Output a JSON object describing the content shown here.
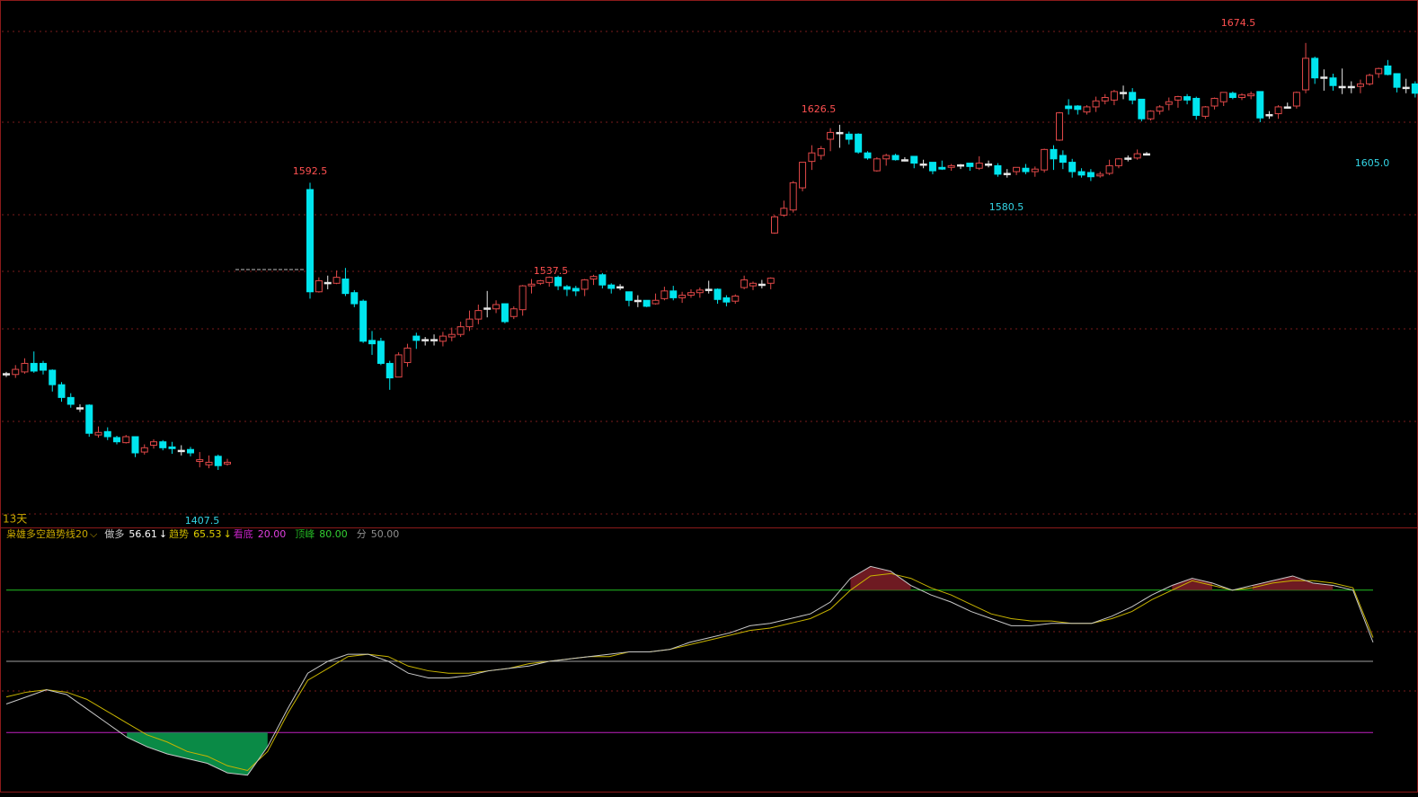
{
  "colors": {
    "background": "#000000",
    "frame": "#8b1a1a",
    "grid": "#7a1c1c",
    "up": "#e04848",
    "down": "#00e5ee",
    "doji": "#e8e8e8",
    "label_high": "#ff5050",
    "label_low": "#33d6e6",
    "indicator_white": "#c8c8c8",
    "indicator_yellow": "#c8b400",
    "line_top": "#22c022",
    "line_mid": "#a0a0a0",
    "line_bottom": "#c020c0",
    "fill_top": "#6e1a22",
    "fill_bottom": "#0a8a46",
    "dashed_ref": "#bbbbbb"
  },
  "chart_data": [
    {
      "type": "candlestick",
      "period_label": "13天",
      "ylim": [
        1395,
        1686
      ],
      "candles": [
        [
          1480.0,
          1480.5,
          1481.5,
          1478.5
        ],
        [
          1480.0,
          1483.0,
          1485.5,
          1478.0
        ],
        [
          1481.5,
          1486.5,
          1489.5,
          1480.5
        ],
        [
          1486.5,
          1482.0,
          1493.5,
          1481.0
        ],
        [
          1486.5,
          1482.5,
          1488.0,
          1480.0
        ],
        [
          1482.5,
          1474.0,
          1483.0,
          1470.0
        ],
        [
          1474.0,
          1466.5,
          1475.5,
          1464.0
        ],
        [
          1466.5,
          1462.5,
          1469.0,
          1460.5
        ],
        [
          1460.5,
          1460.5,
          1462.5,
          1458.0
        ],
        [
          1462.0,
          1445.5,
          1462.5,
          1443.5
        ],
        [
          1444.5,
          1446.0,
          1449.5,
          1443.0
        ],
        [
          1446.5,
          1443.5,
          1449.0,
          1441.5
        ],
        [
          1443.0,
          1440.5,
          1444.0,
          1439.0
        ],
        [
          1440.0,
          1443.5,
          1444.5,
          1439.5
        ],
        [
          1443.5,
          1434.0,
          1443.5,
          1431.5
        ],
        [
          1434.5,
          1437.0,
          1439.0,
          1433.0
        ],
        [
          1438.5,
          1440.5,
          1442.0,
          1436.5
        ],
        [
          1440.5,
          1437.0,
          1441.5,
          1435.5
        ],
        [
          1437.5,
          1436.5,
          1440.5,
          1433.5
        ],
        [
          1435.5,
          1435.5,
          1438.5,
          1432.5
        ],
        [
          1436.0,
          1434.0,
          1437.5,
          1432.0
        ],
        [
          1429.0,
          1430.0,
          1434.5,
          1425.5
        ],
        [
          1427.0,
          1428.5,
          1432.5,
          1425.0
        ],
        [
          1432.0,
          1426.5,
          1433.0,
          1424.0
        ],
        [
          1427.5,
          1428.5,
          1430.5,
          1426.5
        ],
        [
          1588.5,
          1528.5,
          1592.5,
          1524.5
        ],
        [
          1528.5,
          1535.0,
          1537.0,
          1528.0
        ],
        [
          1533.5,
          1534.0,
          1538.0,
          1530.0
        ],
        [
          1533.5,
          1537.0,
          1541.0,
          1533.0
        ],
        [
          1536.0,
          1527.5,
          1542.5,
          1526.0
        ],
        [
          1528.0,
          1521.5,
          1529.5,
          1519.5
        ],
        [
          1523.0,
          1499.5,
          1524.0,
          1498.5
        ],
        [
          1500.0,
          1498.0,
          1505.5,
          1491.5
        ],
        [
          1499.5,
          1486.5,
          1501.5,
          1485.5
        ],
        [
          1486.5,
          1478.0,
          1488.0,
          1471.0
        ],
        [
          1478.5,
          1491.5,
          1493.0,
          1480.0
        ],
        [
          1487.0,
          1495.5,
          1498.0,
          1484.5
        ],
        [
          1502.5,
          1500.0,
          1504.5,
          1495.0
        ],
        [
          1500.5,
          1500.5,
          1502.0,
          1497.0
        ],
        [
          1500.5,
          1500.5,
          1503.5,
          1497.0
        ],
        [
          1499.5,
          1502.5,
          1505.0,
          1496.5
        ],
        [
          1502.0,
          1503.5,
          1507.5,
          1499.5
        ],
        [
          1503.5,
          1508.0,
          1511.0,
          1502.0
        ],
        [
          1508.0,
          1512.5,
          1517.5,
          1505.5
        ],
        [
          1512.5,
          1517.5,
          1521.0,
          1509.5
        ],
        [
          1519.0,
          1518.5,
          1529.0,
          1513.5
        ],
        [
          1518.5,
          1521.0,
          1523.5,
          1516.0
        ],
        [
          1521.5,
          1511.0,
          1521.5,
          1510.0
        ],
        [
          1514.0,
          1518.5,
          1520.0,
          1512.5
        ],
        [
          1518.0,
          1532.0,
          1532.5,
          1514.5
        ],
        [
          1532.0,
          1533.0,
          1536.0,
          1527.5
        ],
        [
          1533.5,
          1535.0,
          1535.5,
          1532.5
        ],
        [
          1534.0,
          1537.0,
          1537.5,
          1531.5
        ],
        [
          1537.0,
          1532.0,
          1538.0,
          1529.5
        ],
        [
          1531.5,
          1530.0,
          1532.5,
          1526.0
        ],
        [
          1530.5,
          1529.0,
          1532.0,
          1526.0
        ],
        [
          1530.0,
          1535.5,
          1536.0,
          1526.0
        ],
        [
          1536.0,
          1537.5,
          1538.5,
          1532.5
        ],
        [
          1538.5,
          1532.5,
          1539.5,
          1530.5
        ],
        [
          1532.5,
          1530.5,
          1533.5,
          1527.5
        ],
        [
          1531.5,
          1531.5,
          1533.0,
          1529.5
        ],
        [
          1528.5,
          1523.5,
          1528.5,
          1520.0
        ],
        [
          1523.5,
          1523.5,
          1526.5,
          1519.5
        ],
        [
          1523.5,
          1520.0,
          1523.5,
          1519.5
        ],
        [
          1521.5,
          1523.5,
          1527.5,
          1521.0
        ],
        [
          1524.5,
          1529.0,
          1531.5,
          1523.5
        ],
        [
          1529.0,
          1525.0,
          1532.0,
          1523.5
        ],
        [
          1525.0,
          1526.5,
          1528.5,
          1522.0
        ],
        [
          1526.5,
          1528.0,
          1530.0,
          1525.0
        ],
        [
          1528.0,
          1529.5,
          1531.0,
          1525.0
        ],
        [
          1529.5,
          1530.0,
          1535.0,
          1527.5
        ],
        [
          1530.0,
          1524.0,
          1530.5,
          1521.5
        ],
        [
          1525.0,
          1522.5,
          1526.5,
          1520.0
        ],
        [
          1523.0,
          1526.0,
          1527.0,
          1521.5
        ],
        [
          1531.0,
          1535.5,
          1538.0,
          1530.0
        ],
        [
          1532.0,
          1533.5,
          1534.5,
          1529.5
        ],
        [
          1533.0,
          1532.5,
          1535.5,
          1530.5
        ],
        [
          1533.5,
          1536.5,
          1537.0,
          1530.0
        ],
        [
          1563.0,
          1572.5,
          1573.5,
          1562.5
        ],
        [
          1573.5,
          1577.5,
          1582.0,
          1572.5
        ],
        [
          1576.5,
          1592.5,
          1593.5,
          1575.0
        ],
        [
          1589.5,
          1604.5,
          1604.5,
          1587.5
        ],
        [
          1605.0,
          1610.0,
          1614.5,
          1600.0
        ],
        [
          1608.5,
          1612.5,
          1614.0,
          1606.0
        ],
        [
          1618.0,
          1622.0,
          1624.5,
          1611.0
        ],
        [
          1622.0,
          1621.5,
          1626.5,
          1613.0
        ],
        [
          1621.0,
          1618.0,
          1622.5,
          1615.0
        ],
        [
          1621.0,
          1610.5,
          1621.5,
          1609.5
        ],
        [
          1610.0,
          1607.0,
          1611.0,
          1606.0
        ],
        [
          1599.5,
          1606.5,
          1607.5,
          1599.0
        ],
        [
          1606.5,
          1608.5,
          1609.5,
          1602.5
        ],
        [
          1608.5,
          1606.0,
          1609.5,
          1605.5
        ],
        [
          1606.0,
          1605.5,
          1607.5,
          1605.0
        ],
        [
          1608.0,
          1604.0,
          1608.0,
          1601.0
        ],
        [
          1603.5,
          1603.5,
          1606.0,
          1601.0
        ],
        [
          1604.5,
          1599.5,
          1604.5,
          1597.5
        ],
        [
          1601.5,
          1600.5,
          1605.5,
          1600.0
        ],
        [
          1601.5,
          1602.5,
          1603.5,
          1599.5
        ],
        [
          1602.5,
          1603.0,
          1603.5,
          1600.5
        ],
        [
          1604.0,
          1602.0,
          1604.0,
          1599.5
        ],
        [
          1601.0,
          1604.0,
          1608.0,
          1600.0
        ],
        [
          1603.5,
          1603.5,
          1605.5,
          1601.5
        ],
        [
          1602.5,
          1597.5,
          1604.0,
          1596.0
        ],
        [
          1597.5,
          1598.0,
          1600.5,
          1595.5
        ],
        [
          1599.0,
          1601.5,
          1601.5,
          1597.0
        ],
        [
          1601.0,
          1599.0,
          1603.5,
          1597.5
        ],
        [
          1599.0,
          1600.5,
          1602.0,
          1596.0
        ],
        [
          1600.0,
          1612.0,
          1612.5,
          1598.5
        ],
        [
          1612.0,
          1606.5,
          1614.5,
          1600.0
        ],
        [
          1608.5,
          1604.5,
          1611.5,
          1600.5
        ],
        [
          1604.5,
          1599.0,
          1606.5,
          1595.5
        ],
        [
          1599.0,
          1597.0,
          1601.0,
          1595.5
        ],
        [
          1598.5,
          1596.0,
          1600.5,
          1593.5
        ],
        [
          1596.5,
          1597.5,
          1599.0,
          1595.5
        ],
        [
          1598.0,
          1602.5,
          1606.0,
          1597.0
        ],
        [
          1602.5,
          1606.5,
          1607.0,
          1601.0
        ],
        [
          1606.5,
          1607.0,
          1608.5,
          1605.0
        ],
        [
          1607.0,
          1609.5,
          1612.0,
          1606.0
        ],
        [
          1609.5,
          1609.5,
          1610.5,
          1608.5
        ],
        [
          1617.5,
          1633.5,
          1634.0,
          1617.0
        ],
        [
          1637.5,
          1636.0,
          1641.5,
          1632.5
        ],
        [
          1637.5,
          1635.5,
          1638.0,
          1632.5
        ],
        [
          1634.0,
          1637.0,
          1638.0,
          1632.5
        ],
        [
          1637.0,
          1640.5,
          1643.0,
          1634.0
        ],
        [
          1640.5,
          1642.5,
          1644.5,
          1638.5
        ],
        [
          1641.0,
          1646.0,
          1647.0,
          1638.0
        ],
        [
          1645.5,
          1645.5,
          1649.5,
          1641.5
        ],
        [
          1645.5,
          1641.0,
          1648.0,
          1638.5
        ],
        [
          1641.5,
          1630.0,
          1641.5,
          1628.5
        ],
        [
          1630.0,
          1634.5,
          1635.0,
          1629.0
        ],
        [
          1634.5,
          1637.0,
          1638.0,
          1632.5
        ],
        [
          1638.5,
          1640.0,
          1642.5,
          1635.0
        ],
        [
          1641.0,
          1643.0,
          1643.5,
          1636.5
        ],
        [
          1643.0,
          1641.0,
          1644.5,
          1638.5
        ],
        [
          1642.0,
          1632.0,
          1643.0,
          1629.5
        ],
        [
          1631.5,
          1637.0,
          1637.5,
          1630.0
        ],
        [
          1637.5,
          1642.0,
          1642.5,
          1635.5
        ],
        [
          1640.0,
          1645.5,
          1645.5,
          1637.5
        ],
        [
          1645.0,
          1642.5,
          1646.0,
          1641.5
        ],
        [
          1642.5,
          1644.0,
          1645.0,
          1641.0
        ],
        [
          1643.5,
          1644.5,
          1646.0,
          1641.5
        ],
        [
          1646.0,
          1630.5,
          1646.0,
          1628.0
        ],
        [
          1632.5,
          1632.5,
          1634.5,
          1630.0
        ],
        [
          1633.0,
          1637.0,
          1638.0,
          1630.0
        ],
        [
          1637.0,
          1637.0,
          1639.5,
          1636.0
        ],
        [
          1637.5,
          1645.5,
          1646.0,
          1636.0
        ],
        [
          1647.0,
          1665.5,
          1674.5,
          1645.0
        ],
        [
          1665.5,
          1654.0,
          1666.5,
          1650.5
        ],
        [
          1654.0,
          1654.5,
          1659.0,
          1646.5
        ],
        [
          1654.0,
          1649.5,
          1656.5,
          1646.5
        ],
        [
          1649.0,
          1648.5,
          1659.5,
          1644.5
        ],
        [
          1649.0,
          1649.0,
          1652.0,
          1645.0
        ],
        [
          1649.0,
          1650.5,
          1653.0,
          1645.0
        ],
        [
          1650.5,
          1655.5,
          1656.5,
          1649.5
        ],
        [
          1656.5,
          1659.5,
          1660.0,
          1654.0
        ],
        [
          1661.0,
          1656.0,
          1664.5,
          1655.5
        ],
        [
          1656.5,
          1648.5,
          1656.5,
          1645.5
        ],
        [
          1648.5,
          1648.5,
          1653.5,
          1645.0
        ],
        [
          1650.5,
          1645.0,
          1652.0,
          1642.5
        ],
        [
          1647.0,
          1641.0,
          1647.5,
          1638.5
        ],
        [
          1641.0,
          1633.5,
          1642.0,
          1632.0
        ],
        [
          1633.5,
          1622.5,
          1634.0,
          1620.0
        ],
        [
          1622.0,
          1611.5,
          1625.0,
          1609.0
        ],
        [
          1611.5,
          1612.5,
          1615.5,
          1605.0
        ]
      ],
      "annotations": [
        {
          "text": "1592.5",
          "color": "label_high"
        },
        {
          "text": "1537.5",
          "color": "label_high"
        },
        {
          "text": "1626.5",
          "color": "label_high"
        },
        {
          "text": "1674.5",
          "color": "label_high"
        },
        {
          "text": "1407.5",
          "color": "label_low"
        },
        {
          "text": "1580.5",
          "color": "label_low"
        },
        {
          "text": "1605.0",
          "color": "label_low"
        }
      ]
    },
    {
      "type": "line",
      "title": "枭雄多空趋势线20",
      "ylim": [
        0,
        100
      ],
      "levels": {
        "do_long": {
          "label": "做多",
          "value": "56.61",
          "arrow": "↓"
        },
        "trend": {
          "label": "趋势",
          "value": "65.53",
          "arrow": "↓"
        },
        "bottom": {
          "label": "看底",
          "value": "20.00"
        },
        "top": {
          "label": "顶峰",
          "value": "80.00"
        },
        "mid": {
          "label": "分",
          "value": "50.00"
        }
      },
      "series": [
        {
          "color": "indicator_white",
          "values": [
            32,
            35,
            38,
            36,
            30,
            24,
            18,
            14,
            11,
            9,
            7,
            3,
            2,
            14,
            30,
            45,
            50,
            53,
            53,
            50,
            45,
            43,
            43,
            44,
            46,
            47,
            48,
            50,
            51,
            52,
            53,
            54,
            54,
            55,
            58,
            60,
            62,
            65,
            66,
            68,
            70,
            75,
            85,
            90,
            88,
            82,
            78,
            75,
            71,
            68,
            65,
            65,
            66,
            66,
            66,
            69,
            73,
            78,
            82,
            85,
            83,
            80,
            82,
            84,
            86,
            83,
            82,
            80,
            58
          ]
        },
        {
          "color": "indicator_yellow",
          "values": [
            35,
            37,
            38,
            37,
            34,
            29,
            24,
            19,
            16,
            12,
            10,
            6,
            4,
            12,
            28,
            42,
            47,
            52,
            53,
            52,
            48,
            46,
            45,
            45,
            46,
            47,
            49,
            50,
            51,
            52,
            52,
            54,
            54,
            55,
            57,
            59,
            61,
            63,
            64,
            66,
            68,
            72,
            80,
            86,
            87,
            85,
            81,
            78,
            74,
            70,
            68,
            67,
            67,
            66,
            66,
            68,
            71,
            76,
            80,
            84,
            82,
            80,
            81,
            83,
            84,
            84,
            83,
            81,
            60
          ]
        }
      ]
    }
  ]
}
